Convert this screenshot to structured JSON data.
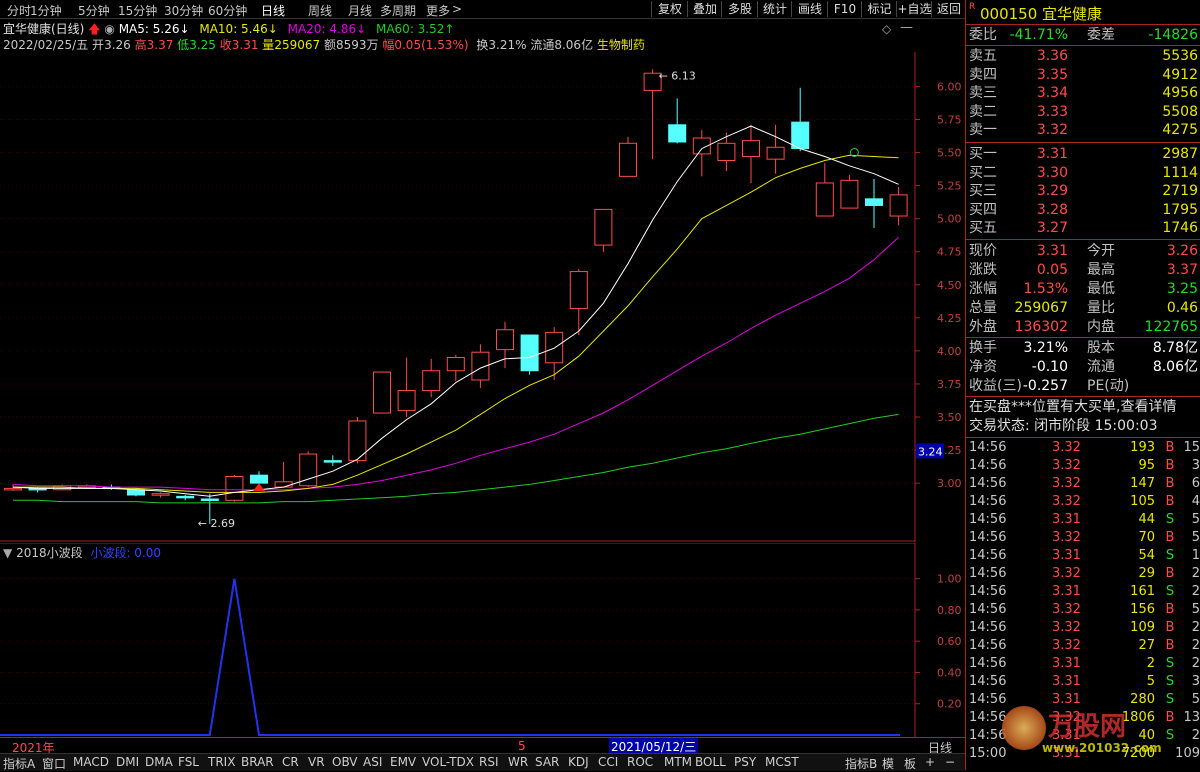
{
  "periods": [
    "分时",
    "1分钟",
    "5分钟",
    "15分钟",
    "30分钟",
    "60分钟",
    "日线",
    "周线",
    "月线",
    "多周期",
    "更多"
  ],
  "period_more_icon": "chevron-right-icon",
  "toolbar": [
    "复权",
    "叠加",
    "多股",
    "统计",
    "画线",
    "F10",
    "标记",
    "+自选",
    "返回"
  ],
  "stock": {
    "name": "宜华健康",
    "code": "000150",
    "badge": "R"
  },
  "info1": {
    "title": "宜华健康(日线)",
    "ma5": "MA5: 5.26",
    "ma10": "MA10: 5.46",
    "ma20": "MA20: 4.86",
    "ma60": "MA60: 3.52"
  },
  "info2": {
    "date": "2022/02/25/五",
    "open_l": "开",
    "open": "3.26",
    "high_l": "高",
    "high": "3.37",
    "low_l": "低",
    "low": "3.25",
    "close_l": "收",
    "close": "3.31",
    "vol_l": "量",
    "vol": "259067",
    "amt_l": "额",
    "amt": "8593万",
    "chg_l": "幅",
    "chg": "0.05(1.53%)",
    "turn": "换3.21%",
    "float": "流通8.06亿",
    "sector": "生物制药"
  },
  "colors": {
    "ma5": "#ffffff",
    "ma10": "#e6e600",
    "ma20": "#e000e0",
    "ma60": "#22cc22",
    "up": "#ff4b4b",
    "down": "#55ffff",
    "wave": "#2233ee"
  },
  "price_axis": [
    "6.00",
    "5.75",
    "5.50",
    "5.25",
    "5.00",
    "4.75",
    "4.50",
    "4.25",
    "4.00",
    "3.75",
    "3.50",
    "3.25",
    "3.00"
  ],
  "current_price_tag": "3.24",
  "annotations": {
    "high": "6.13",
    "low": "2.69"
  },
  "indicator": {
    "name": "2018小波段",
    "line": "小波段: 0.00",
    "axis": [
      "1.00",
      "0.80",
      "0.60",
      "0.40",
      "0.20"
    ]
  },
  "xaxis": {
    "year": "2021年",
    "month": "5",
    "date": "2021/05/12/三",
    "period": "日线"
  },
  "tabs": [
    "指标A",
    "窗口",
    "MACD",
    "DMI",
    "DMA",
    "FSL",
    "TRIX",
    "BRAR",
    "CR",
    "VR",
    "OBV",
    "ASI",
    "EMV",
    "VOL-TDX",
    "RSI",
    "WR",
    "SAR",
    "KDJ",
    "CCI",
    "ROC",
    "MTM",
    "BOLL",
    "PSY",
    "MCST",
    "指标B",
    "模",
    "板",
    "+",
    "−"
  ],
  "book": {
    "webi_l": "委比",
    "webi": "-41.71%",
    "wecha_l": "委差",
    "wecha": "-14826",
    "asks": [
      {
        "label": "卖五",
        "price": "3.36",
        "vol": "5536"
      },
      {
        "label": "卖四",
        "price": "3.35",
        "vol": "4912"
      },
      {
        "label": "卖三",
        "price": "3.34",
        "vol": "4956"
      },
      {
        "label": "卖二",
        "price": "3.33",
        "vol": "5508"
      },
      {
        "label": "卖一",
        "price": "3.32",
        "vol": "4275"
      }
    ],
    "bids": [
      {
        "label": "买一",
        "price": "3.31",
        "vol": "2987"
      },
      {
        "label": "买二",
        "price": "3.30",
        "vol": "1114"
      },
      {
        "label": "买三",
        "price": "3.29",
        "vol": "2719"
      },
      {
        "label": "买四",
        "price": "3.28",
        "vol": "1795"
      },
      {
        "label": "买五",
        "price": "3.27",
        "vol": "1746"
      }
    ]
  },
  "quote": [
    {
      "l1": "现价",
      "v1": "3.31",
      "l2": "今开",
      "v2": "3.26",
      "c1": "red",
      "c2": "red"
    },
    {
      "l1": "涨跌",
      "v1": "0.05",
      "l2": "最高",
      "v2": "3.37",
      "c1": "red",
      "c2": "red"
    },
    {
      "l1": "涨幅",
      "v1": "1.53%",
      "l2": "最低",
      "v2": "3.25",
      "c1": "red",
      "c2": "green"
    },
    {
      "l1": "总量",
      "v1": "259067",
      "l2": "量比",
      "v2": "0.46",
      "c1": "yellow",
      "c2": "yellow"
    },
    {
      "l1": "外盘",
      "v1": "136302",
      "l2": "内盘",
      "v2": "122765",
      "c1": "red",
      "c2": "green"
    }
  ],
  "stats": [
    {
      "l1": "换手",
      "v1": "3.21%",
      "l2": "股本",
      "v2": "8.78亿"
    },
    {
      "l1": "净资",
      "v1": "-0.10",
      "l2": "流通",
      "v2": "8.06亿"
    },
    {
      "l1": "收益(三)",
      "v1": "-0.257",
      "l2": "PE(动)",
      "v2": ""
    }
  ],
  "notice": "在买盘***位置有大买单,查看详情",
  "status": "交易状态: 闭市阶段 15:00:03",
  "ticks": [
    [
      "14:56",
      "3.32",
      "193",
      "B",
      "15"
    ],
    [
      "14:56",
      "3.32",
      "95",
      "B",
      "3"
    ],
    [
      "14:56",
      "3.32",
      "147",
      "B",
      "6"
    ],
    [
      "14:56",
      "3.32",
      "105",
      "B",
      "4"
    ],
    [
      "14:56",
      "3.31",
      "44",
      "S",
      "5"
    ],
    [
      "14:56",
      "3.32",
      "70",
      "B",
      "5"
    ],
    [
      "14:56",
      "3.31",
      "54",
      "S",
      "1"
    ],
    [
      "14:56",
      "3.32",
      "29",
      "B",
      "2"
    ],
    [
      "14:56",
      "3.31",
      "161",
      "S",
      "2"
    ],
    [
      "14:56",
      "3.32",
      "156",
      "B",
      "5"
    ],
    [
      "14:56",
      "3.32",
      "109",
      "B",
      "2"
    ],
    [
      "14:56",
      "3.32",
      "27",
      "B",
      "2"
    ],
    [
      "14:56",
      "3.31",
      "2",
      "S",
      "2"
    ],
    [
      "14:56",
      "3.31",
      "5",
      "S",
      "3"
    ],
    [
      "14:56",
      "3.31",
      "280",
      "S",
      "5"
    ],
    [
      "14:56",
      "3.32",
      "1806",
      "B",
      "13"
    ],
    [
      "14:56",
      "3.31",
      "40",
      "S",
      "2"
    ],
    [
      "15:00",
      "3.31",
      "7200",
      "",
      "109"
    ]
  ],
  "watermark": {
    "text": "万股网",
    "url": "www.201032.com"
  },
  "chart_data": {
    "type": "candlestick",
    "candles": [
      [
        2.95,
        2.99,
        2.94,
        2.96
      ],
      [
        2.96,
        2.97,
        2.93,
        2.95
      ],
      [
        2.95,
        2.99,
        2.95,
        2.98
      ],
      [
        2.97,
        2.99,
        2.96,
        2.98
      ],
      [
        2.97,
        2.99,
        2.95,
        2.96
      ],
      [
        2.95,
        2.96,
        2.9,
        2.91
      ],
      [
        2.91,
        2.93,
        2.89,
        2.92
      ],
      [
        2.9,
        2.91,
        2.87,
        2.89
      ],
      [
        2.88,
        2.92,
        2.69,
        2.87
      ],
      [
        2.87,
        3.06,
        2.86,
        3.05
      ],
      [
        3.06,
        3.09,
        2.97,
        3.0
      ],
      [
        2.97,
        3.16,
        2.97,
        3.01
      ],
      [
        2.98,
        3.24,
        2.97,
        3.22
      ],
      [
        3.17,
        3.21,
        3.13,
        3.16
      ],
      [
        3.17,
        3.5,
        3.15,
        3.47
      ],
      [
        3.53,
        3.84,
        3.53,
        3.84
      ],
      [
        3.55,
        3.95,
        3.5,
        3.7
      ],
      [
        3.7,
        3.94,
        3.65,
        3.85
      ],
      [
        3.85,
        3.97,
        3.77,
        3.95
      ],
      [
        3.78,
        4.05,
        3.72,
        3.99
      ],
      [
        4.01,
        4.22,
        3.87,
        4.16
      ],
      [
        4.12,
        4.12,
        3.82,
        3.85
      ],
      [
        3.91,
        4.18,
        3.78,
        4.14
      ],
      [
        4.32,
        4.62,
        4.12,
        4.6
      ],
      [
        4.8,
        5.07,
        4.75,
        5.07
      ],
      [
        5.32,
        5.62,
        5.32,
        5.57
      ],
      [
        5.97,
        6.13,
        5.45,
        6.1
      ],
      [
        5.71,
        5.91,
        5.57,
        5.58
      ],
      [
        5.49,
        5.67,
        5.32,
        5.61
      ],
      [
        5.44,
        5.65,
        5.36,
        5.57
      ],
      [
        5.47,
        5.71,
        5.27,
        5.59
      ],
      [
        5.45,
        5.71,
        5.34,
        5.54
      ],
      [
        5.73,
        5.99,
        5.51,
        5.53
      ],
      [
        5.02,
        5.42,
        5.02,
        5.27
      ],
      [
        5.08,
        5.33,
        5.08,
        5.29
      ],
      [
        5.15,
        5.3,
        4.93,
        5.1
      ],
      [
        5.02,
        5.24,
        4.95,
        5.18
      ]
    ],
    "ma5": [
      2.97,
      2.96,
      2.96,
      2.96,
      2.96,
      2.95,
      2.94,
      2.92,
      2.9,
      2.93,
      2.95,
      2.97,
      3.03,
      3.09,
      3.18,
      3.34,
      3.48,
      3.6,
      3.76,
      3.87,
      3.94,
      3.95,
      4.02,
      4.15,
      4.36,
      4.66,
      4.99,
      5.28,
      5.53,
      5.62,
      5.7,
      5.62,
      5.53,
      5.47,
      5.4,
      5.34,
      5.26
    ],
    "ma10": [
      2.97,
      2.97,
      2.97,
      2.96,
      2.96,
      2.96,
      2.95,
      2.94,
      2.93,
      2.93,
      2.93,
      2.94,
      2.96,
      2.99,
      3.06,
      3.14,
      3.22,
      3.31,
      3.4,
      3.52,
      3.64,
      3.74,
      3.82,
      3.96,
      4.15,
      4.34,
      4.56,
      4.77,
      5.0,
      5.1,
      5.2,
      5.31,
      5.38,
      5.44,
      5.48,
      5.47,
      5.46
    ],
    "ma20": [
      2.99,
      2.98,
      2.98,
      2.98,
      2.97,
      2.97,
      2.97,
      2.96,
      2.95,
      2.95,
      2.95,
      2.95,
      2.96,
      2.97,
      2.99,
      3.02,
      3.06,
      3.1,
      3.15,
      3.21,
      3.26,
      3.31,
      3.37,
      3.45,
      3.53,
      3.63,
      3.74,
      3.85,
      3.96,
      4.06,
      4.17,
      4.27,
      4.36,
      4.45,
      4.55,
      4.69,
      4.86
    ],
    "ma60": [
      2.87,
      2.87,
      2.86,
      2.86,
      2.86,
      2.86,
      2.85,
      2.85,
      2.85,
      2.85,
      2.85,
      2.86,
      2.86,
      2.87,
      2.88,
      2.89,
      2.9,
      2.92,
      2.93,
      2.95,
      2.97,
      2.99,
      3.02,
      3.05,
      3.08,
      3.12,
      3.15,
      3.19,
      3.23,
      3.26,
      3.3,
      3.34,
      3.37,
      3.41,
      3.45,
      3.49,
      3.52
    ],
    "y_range": [
      2.6,
      6.2
    ],
    "wave": {
      "ylim": [
        0,
        1.1
      ],
      "values": [
        0,
        0,
        0,
        0,
        0,
        0,
        0,
        0,
        0,
        1,
        0,
        0,
        0,
        0,
        0,
        0,
        0,
        0,
        0,
        0,
        0,
        0,
        0,
        0,
        0,
        0,
        0,
        0,
        0,
        0,
        0,
        0,
        0,
        0,
        0,
        0,
        0
      ]
    }
  }
}
